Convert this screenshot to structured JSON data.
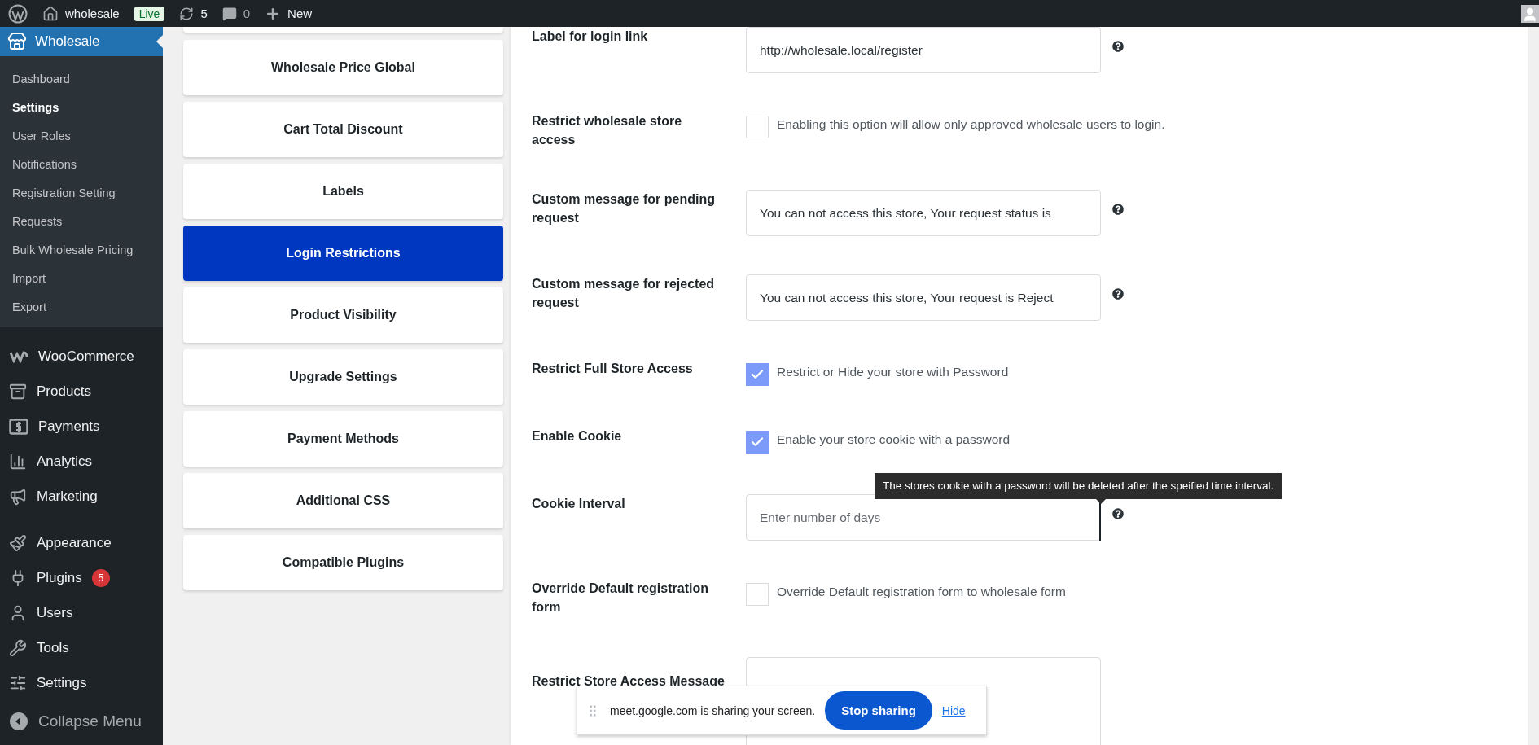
{
  "admin_bar": {
    "site_name": "wholesale",
    "live_badge": "Live",
    "updates_count": "5",
    "comments_count": "0",
    "new_label": "New"
  },
  "sidebar": {
    "current_menu": "Wholesale",
    "submenu": [
      {
        "label": "Dashboard",
        "selected": false
      },
      {
        "label": "Settings",
        "selected": true
      },
      {
        "label": "User Roles",
        "selected": false
      },
      {
        "label": "Notifications",
        "selected": false
      },
      {
        "label": "Registration Setting",
        "selected": false
      },
      {
        "label": "Requests",
        "selected": false
      },
      {
        "label": "Bulk Wholesale Pricing",
        "selected": false
      },
      {
        "label": "Import",
        "selected": false
      },
      {
        "label": "Export",
        "selected": false
      }
    ],
    "menu_groups": [
      [
        {
          "label": "WooCommerce"
        },
        {
          "label": "Products"
        },
        {
          "label": "Payments"
        },
        {
          "label": "Analytics"
        },
        {
          "label": "Marketing"
        }
      ],
      [
        {
          "label": "Appearance"
        },
        {
          "label": "Plugins",
          "badge": "5"
        },
        {
          "label": "Users"
        },
        {
          "label": "Tools"
        },
        {
          "label": "Settings"
        }
      ]
    ],
    "collapse_label": "Collapse Menu"
  },
  "settings_tabs": [
    {
      "label": "Wholesale Price Global",
      "selected": false
    },
    {
      "label": "Cart Total Discount",
      "selected": false
    },
    {
      "label": "Labels",
      "selected": false
    },
    {
      "label": "Login Restrictions",
      "selected": true
    },
    {
      "label": "Product Visibility",
      "selected": false
    },
    {
      "label": "Upgrade Settings",
      "selected": false
    },
    {
      "label": "Payment Methods",
      "selected": false
    },
    {
      "label": "Additional CSS",
      "selected": false
    },
    {
      "label": "Compatible Plugins",
      "selected": false
    }
  ],
  "form_rows": [
    {
      "kind": "text",
      "label": "Label for login link",
      "value": "http://wholesale.local/register"
    },
    {
      "kind": "checkbox",
      "label": "Restrict wholesale store access",
      "checked": false,
      "description": "Enabling this option will allow only approved wholesale users to login."
    },
    {
      "kind": "text",
      "label": "Custom message for pending request",
      "value": "You can not access this store, Your request status is"
    },
    {
      "kind": "text",
      "label": "Custom message for rejected request",
      "value": "You can not access this store, Your request is Reject"
    },
    {
      "kind": "checkbox",
      "label": "Restrict Full Store Access",
      "checked": true,
      "description": "Restrict or Hide your store with Password"
    },
    {
      "kind": "checkbox",
      "label": "Enable Cookie",
      "checked": true,
      "description": "Enable your store cookie with a password"
    },
    {
      "kind": "text",
      "label": "Cookie Interval",
      "placeholder": "Enter number of days",
      "tooltip": "The stores cookie with a password will be deleted after the speified time interval."
    },
    {
      "kind": "checkbox",
      "label": "Override Default registration form",
      "checked": false,
      "description": "Override Default registration form to wholesale form"
    },
    {
      "kind": "textarea",
      "label": "Restrict Store Access Message"
    }
  ],
  "screen_share_bar": {
    "message": "meet.google.com is sharing your screen.",
    "stop_button": "Stop sharing",
    "hide_link": "Hide"
  }
}
